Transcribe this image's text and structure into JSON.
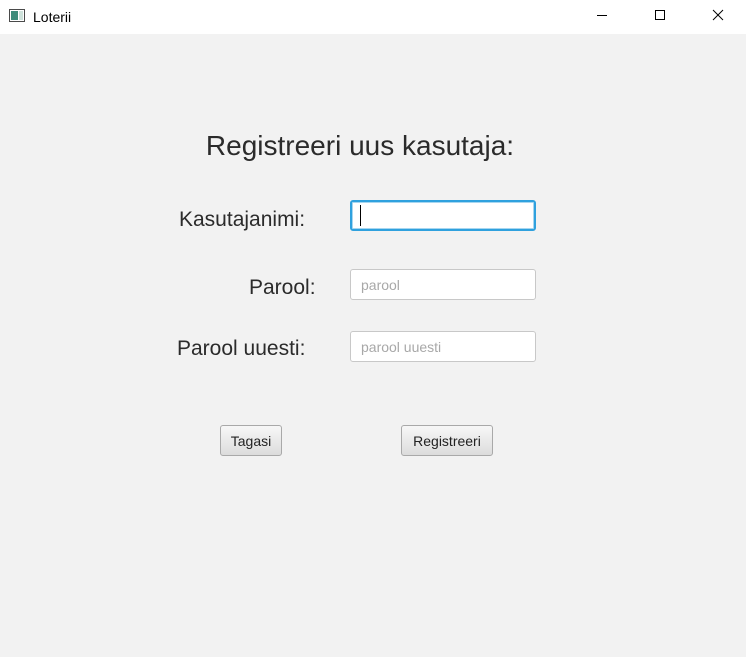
{
  "window": {
    "title": "Loterii",
    "icon": "app-window-icon",
    "controls": {
      "minimize_icon": "minimize-icon",
      "maximize_icon": "maximize-icon",
      "close_icon": "close-icon"
    }
  },
  "form": {
    "heading": "Registreeri uus kasutaja:",
    "username": {
      "label": "Kasutajanimi:",
      "value": "",
      "placeholder": "",
      "focused": true
    },
    "password": {
      "label": "Parool:",
      "value": "",
      "placeholder": "parool"
    },
    "password_repeat": {
      "label": "Parool uuesti:",
      "value": "",
      "placeholder": "parool uuesti"
    }
  },
  "buttons": {
    "back_label": "Tagasi",
    "register_label": "Registreeri"
  },
  "colors": {
    "background": "#f2f2f2",
    "focus_accent": "#2fa1de",
    "text": "#2b2b2b",
    "placeholder": "#a8a8a8"
  }
}
